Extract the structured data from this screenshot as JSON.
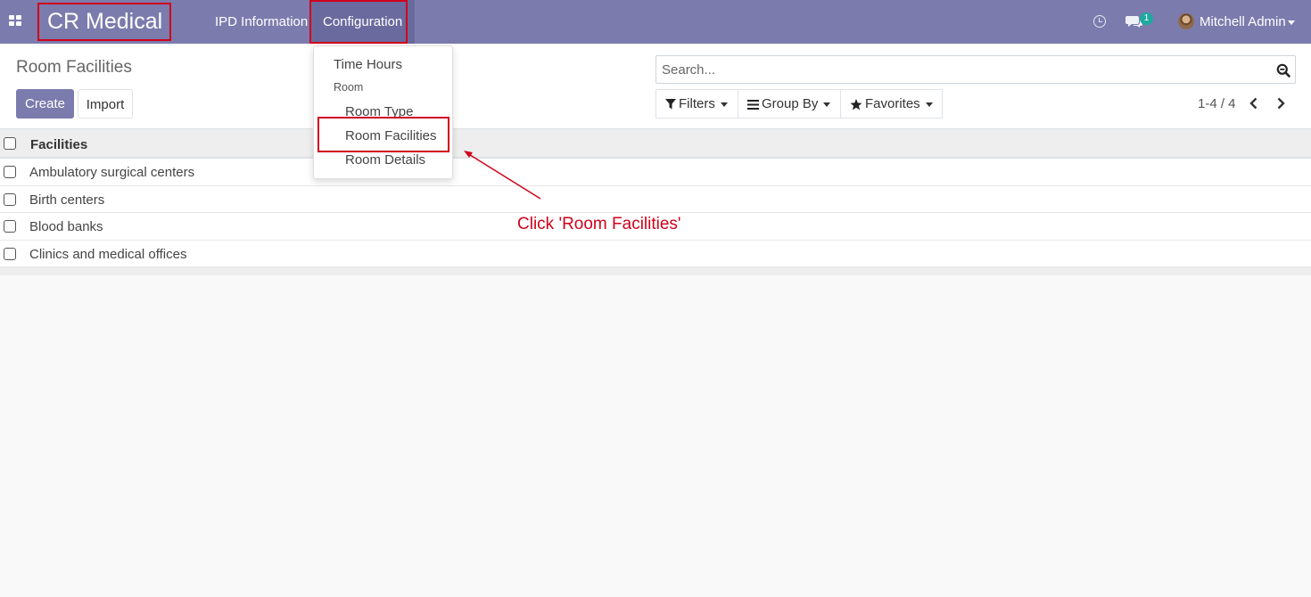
{
  "navbar": {
    "brand": "CR Medical",
    "menu": [
      {
        "label": "IPD Information"
      },
      {
        "label": "Configuration"
      }
    ],
    "chat_badge": "1",
    "user_name": "Mitchell Admin"
  },
  "configuration_menu": {
    "items": [
      {
        "label": "Time Hours"
      },
      {
        "label": "Room",
        "is_header": true
      },
      {
        "label": "Room Type"
      },
      {
        "label": "Room Facilities"
      },
      {
        "label": "Room Details"
      }
    ]
  },
  "control_panel": {
    "breadcrumb": "Room Facilities",
    "create_label": "Create",
    "import_label": "Import",
    "search_placeholder": "Search...",
    "filters_label": "Filters",
    "group_by_label": "Group By",
    "favorites_label": "Favorites",
    "pager": "1-4 / 4"
  },
  "list": {
    "column": "Facilities",
    "rows": [
      "Ambulatory surgical centers",
      "Birth centers",
      "Blood banks",
      "Clinics and medical offices"
    ]
  },
  "annotation": {
    "text": "Click 'Room Facilities'",
    "color": "#d0021b"
  },
  "theme": {
    "navbar": "#7c7bad",
    "primary": "#7c7bad",
    "badge": "#20a8a0"
  }
}
